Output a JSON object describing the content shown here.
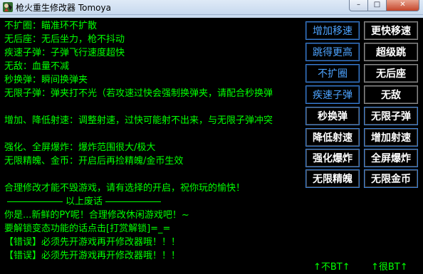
{
  "window": {
    "title": "枪火重生修改器 Tomoya",
    "min_glyph": "–",
    "max_glyph": "□",
    "close_glyph": "✕"
  },
  "console_lines": [
    "不扩圈：瞄准环不扩散",
    "无后座：无后坐力，枪不抖动",
    "疾速子弹：子弹飞行速度超快",
    "无敌：血量不减",
    "秒换弹：瞬间换弹夹",
    "无限子弹：弹夹打不光（若攻速过快会强制换弹夹，请配合秒换弹",
    "增加、降低射速：调整射速，过快可能射不出来，与无限子弹冲突",
    "强化、全屏爆炸：爆炸范围很大/极大",
    "无限精魄、金币：开启后再捡精魄/金币生效",
    "合理修改才能不毁游戏，请有选择的开启，祝你玩的愉快！",
    "以上废话",
    "你是...新鲜的PY呢！合理修改休闲游戏吧！~",
    "要解锁变态功能的话点击[打赏解锁]=_=",
    "【错误】必须先开游戏再开修改器哦！！！",
    "【错误】必须先开游戏再开修改器哦！！！"
  ],
  "buttons": [
    {
      "label": "增加移速"
    },
    {
      "label": "更快移速"
    },
    {
      "label": "跳得更高"
    },
    {
      "label": "超级跳"
    },
    {
      "label": "不扩圈"
    },
    {
      "label": "无后座"
    },
    {
      "label": "疾速子弹"
    },
    {
      "label": "无敌"
    },
    {
      "label": "秒换弹"
    },
    {
      "label": "无限子弹"
    },
    {
      "label": "降低射速"
    },
    {
      "label": "增加射速"
    },
    {
      "label": "强化爆炸"
    },
    {
      "label": "全屏爆炸"
    },
    {
      "label": "无限精魄"
    },
    {
      "label": "无限金币"
    }
  ],
  "links": {
    "not_bt": "↑不BT↑",
    "very_bt": "↑很BT↑"
  },
  "colors": {
    "console_text": "#00ff00",
    "blue_button_text": "#4da3ff",
    "white_button_text": "#ffffff",
    "background": "#000000"
  }
}
